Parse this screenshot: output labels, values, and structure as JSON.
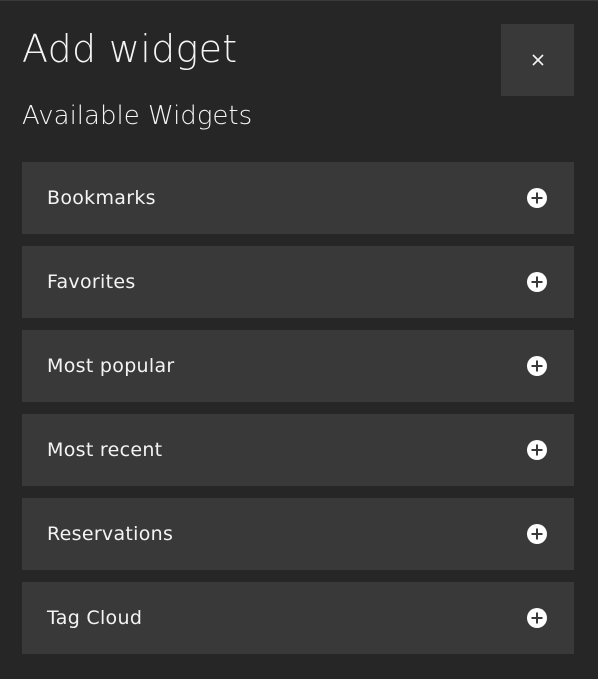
{
  "dialog": {
    "title": "Add widget",
    "subtitle": "Available Widgets",
    "close_icon": "close-icon"
  },
  "widgets": [
    {
      "label": "Bookmarks",
      "icon": "add-circle-icon"
    },
    {
      "label": "Favorites",
      "icon": "add-circle-icon"
    },
    {
      "label": "Most popular",
      "icon": "add-circle-icon"
    },
    {
      "label": "Most recent",
      "icon": "add-circle-icon"
    },
    {
      "label": "Reservations",
      "icon": "add-circle-icon"
    },
    {
      "label": "Tag Cloud",
      "icon": "add-circle-icon"
    }
  ]
}
